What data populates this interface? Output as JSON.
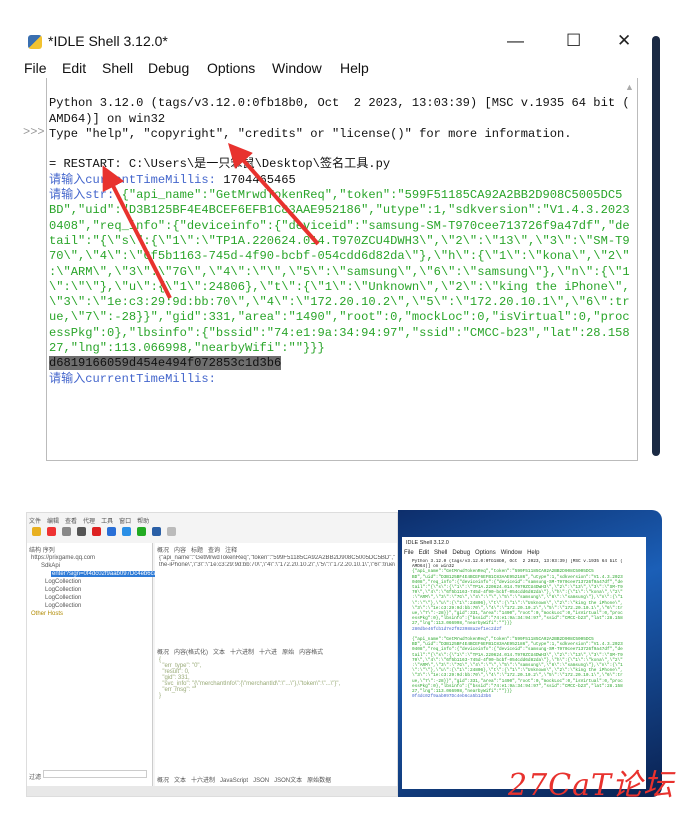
{
  "top_window": {
    "title": "*IDLE Shell 3.12.0*",
    "controls": {
      "minimize": "—",
      "maximize": "☐",
      "close": "✕"
    },
    "menu": [
      "File",
      "Edit",
      "Shell",
      "Debug",
      "Options",
      "Window",
      "Help"
    ],
    "gutter_prompt": ">>>",
    "banner": [
      "Python 3.12.0 (tags/v3.12.0:0fb18b0, Oct  2 2023, 13:03:39) [MSC v.1935 64 bit (",
      "AMD64)] on win32",
      "Type \"help\", \"copyright\", \"credits\" or \"license()\" for more information."
    ],
    "restart_line": "= RESTART: C:\\Users\\是一只笨鼠\\Desktop\\签名工具.py",
    "prompt_time": "请输入currentTimeMillis: ",
    "time_value": "1704465465",
    "prompt_str": "请输入str: ",
    "json_lines": [
      "{\"api_name\":\"GetMrwdTokenReq\",\"token\":\"599F51185CA92A2BB2D908C5005DC5",
      "BD\",\"uid\":\"D3B125BF4E4BCEF6EFB1C83AAE952186\",\"utype\":1,\"sdkversion\":\"V1.4.3.2023",
      "0408\",\"req_info\":{\"deviceinfo\":{\"deviceid\":\"samsung-SM-T970cee713726f9a47df\",\"de",
      "tail\":\"{\\\"s\\\":{\\\"1\\\":\\\"TP1A.220624.014.T970ZCU4DWH3\\\",\\\"2\\\":\\\"13\\\",\\\"3\\\":\\\"SM-T9",
      "70\\\",\\\"4\\\":\\\"6f5b1163-745d-4f90-bcbf-054cdd6d82da\\\"},\\\"h\\\":{\\\"1\\\":\\\"kona\\\",\\\"2\\\"",
      ":\\\"ARM\\\",\\\"3\\\":\\\"7G\\\",\\\"4\\\":\\\"\\\",\\\"5\\\":\\\"samsung\\\",\\\"6\\\":\\\"samsung\\\"},\\\"n\\\":{\\\"1",
      "\\\":\\\"\\\"},\\\"u\\\":{\\\"1\\\":24806},\\\"t\\\":{\\\"1\\\":\\\"Unknown\\\",\\\"2\\\":\\\"king the iPhone\\\",",
      "\\\"3\\\":\\\"1e:c3:29:9d:bb:70\\\",\\\"4\\\":\\\"172.20.10.2\\\",\\\"5\\\":\\\"172.20.10.1\\\",\\\"6\\\":tr",
      "ue,\\\"7\\\":-28}}\",\"gid\":331,\"area\":\"1490\",\"root\":0,\"mockLoc\":0,\"isVirtual\":0,\"proc",
      "essPkg\":0},\"lbsinfo\":{\"bssid\":\"74:e1:9a:34:94:97\",\"ssid\":\"CMCC-b23\",\"lat\":28.158",
      "27,\"lng\":113.066998,\"nearbyWifi\":\"\"}}}"
    ],
    "result_hash": "d6819166059d454e494f072853c1d3b6",
    "prompt_time_2": "请输入currentTimeMillis:"
  },
  "capture_window": {
    "menu": [
      "文件",
      "编辑",
      "查看",
      "代理",
      "工具",
      "窗口",
      "帮助"
    ],
    "left_tabs": [
      "结构",
      "序列"
    ],
    "tree": [
      "https://prixgame.qq.com",
      "SdkApi",
      "enter?sign=0f4dc02f9aab097Dc4eb6ca5",
      "LogCollection",
      "LogCollection",
      "LogCollection",
      "LogCollection",
      "Other Hosts"
    ],
    "request_tabs": [
      "概况",
      "内容",
      "标题",
      "查询",
      "注释"
    ],
    "request_line": "{\"api_name\":\"GetMrwdTokenReq\",\"token\":\"599F51185CA92A2BB2D908C5005DC5BD\",\"uid\"",
    "request_line_2": "the-iPhone\\\",\\\"3\\\":\\\"1e:c3:29:9d:bb:70\\\",\\\"4\\\":\\\"172.20.10.2\\\",\\\"5\\\":\\\"172.20.10.1\\\",\\\"6\\\":true\\\"",
    "response_tabs": [
      "概况",
      "内容(格式化)",
      "文本",
      "十六进制",
      "十六进",
      "原始",
      "内容格式"
    ],
    "response_body": [
      "{",
      "  \"err_type\": \"0\",",
      "  \"result\": 0,",
      "  \"gid\": 331,",
      "  \"svc_info\": \"{\\\"merchantInfo\\\":{\\\"merchantId\\\":\\\"...\\\"},\\\"token\\\":\\\"...\\\"}\",",
      "  \"err_msg\": \"\"",
      "}"
    ],
    "filter_label": "过滤",
    "bottom_tabs": [
      "概况",
      "文本",
      "十六进制",
      "JavaScript",
      "JSON",
      "JSON文本",
      "原始数据"
    ]
  },
  "second_shell": {
    "title": "IDLE Shell 3.12.0",
    "menu": [
      "File",
      "Edit",
      "Shell",
      "Debug",
      "Options",
      "Window",
      "Help"
    ],
    "result_hash_1": "280dbe46fcb1d7e2f023988a2ef1ec2d2f",
    "result_hash_2": "0f4dc02f9aab097Dc4eb6ca5b1d3b6"
  },
  "watermark": "27CaT论坛",
  "colors": {
    "prompt": "#4466cc",
    "string": "#2aa52a",
    "arrow": "#e8322e",
    "highlight": "#6e6e6e"
  }
}
